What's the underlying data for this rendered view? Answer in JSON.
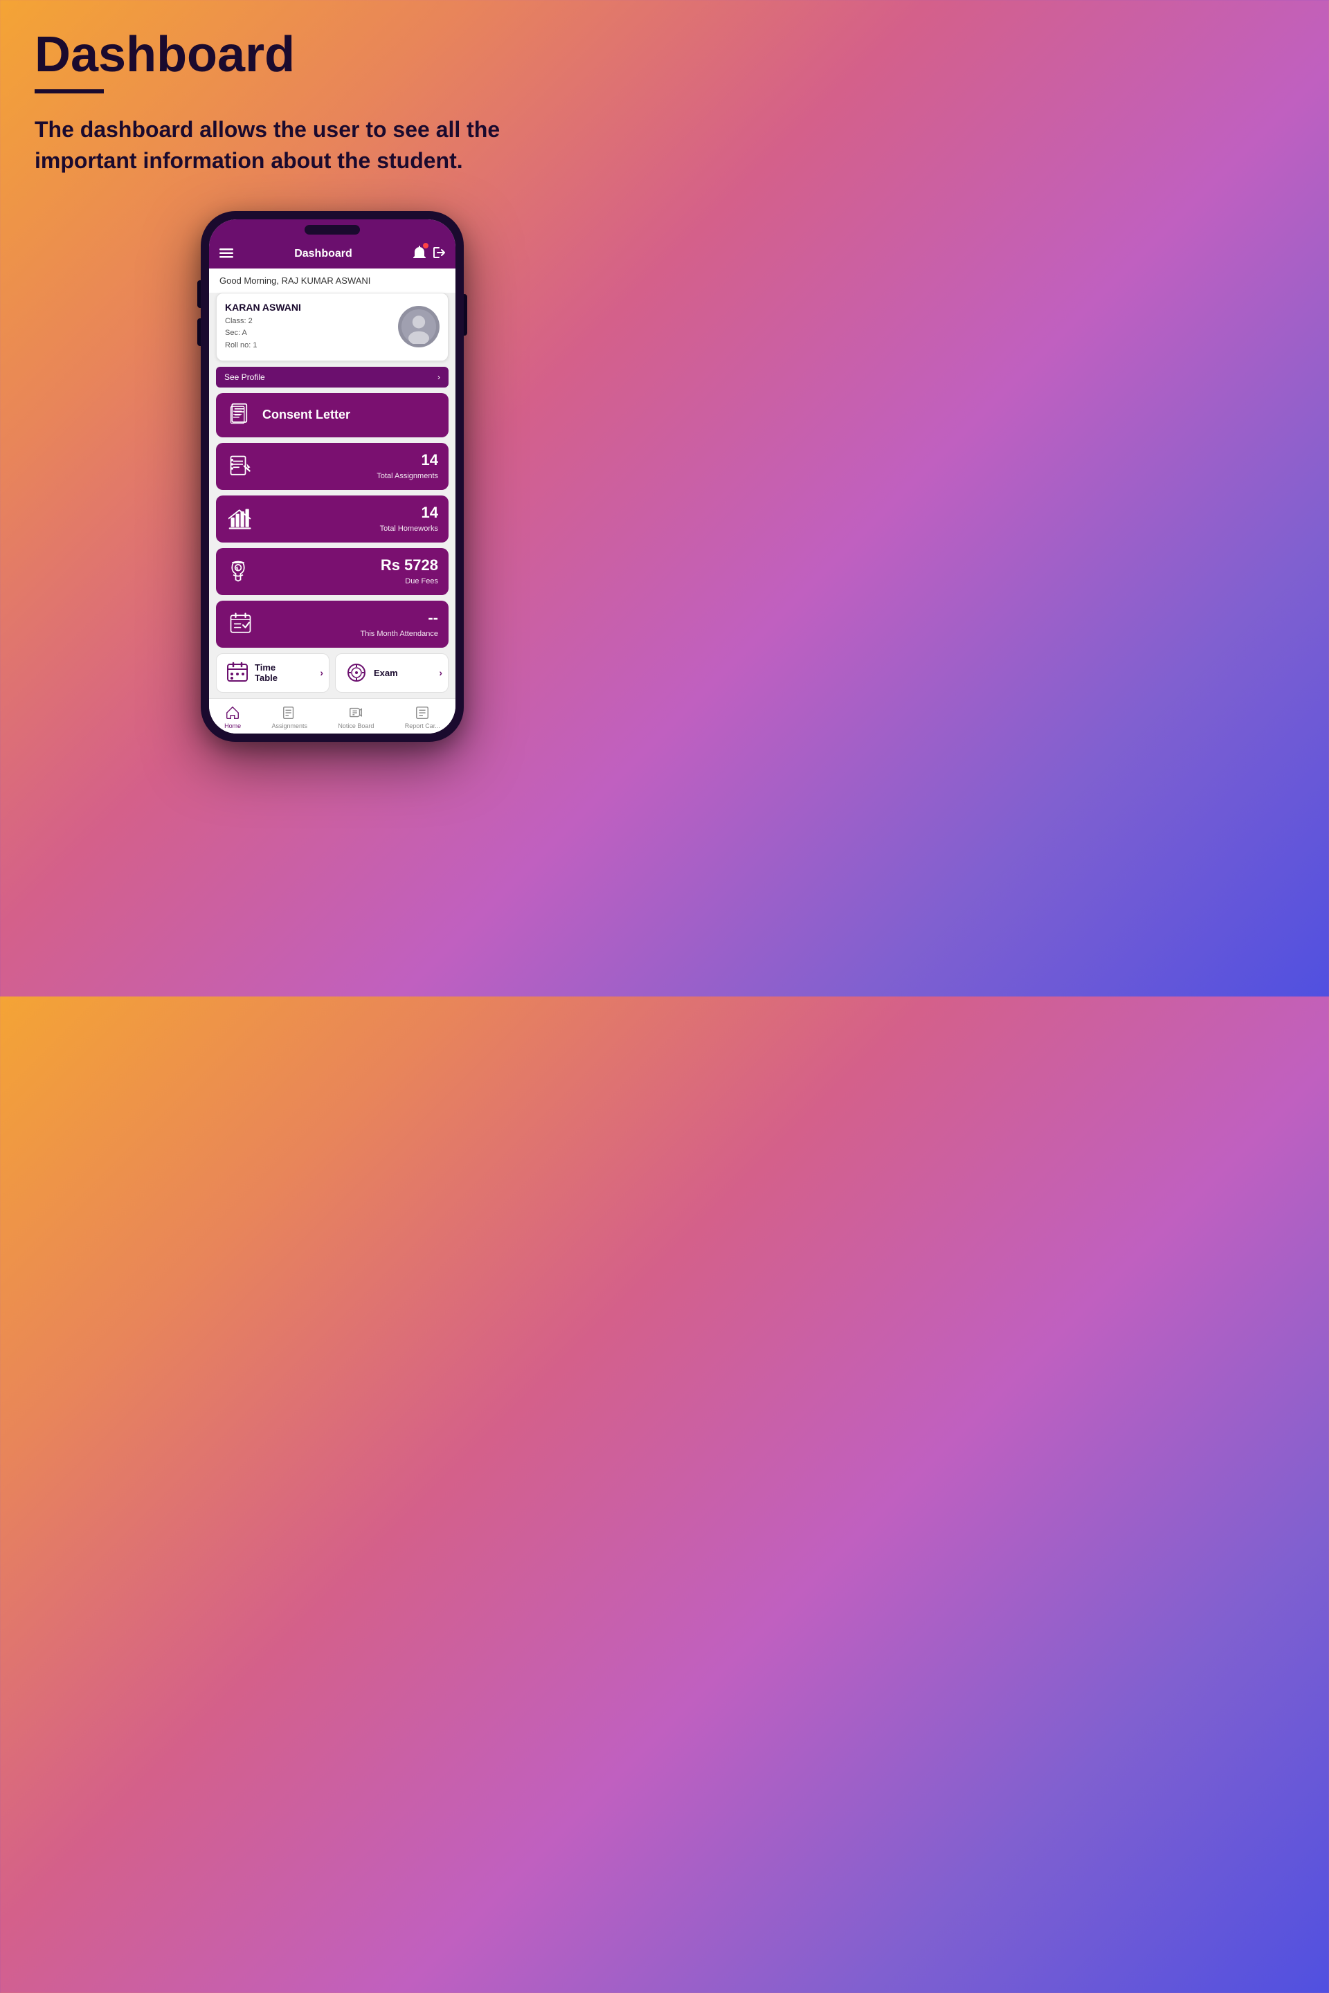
{
  "page": {
    "title": "Dashboard",
    "description": "The dashboard allows the user to see all the important information about the student."
  },
  "app": {
    "header": {
      "title": "Dashboard",
      "menu_icon": "≡",
      "notification_icon": "🔔",
      "logout_icon": "⬚"
    },
    "greeting": "Good Morning, RAJ KUMAR ASWANI",
    "student": {
      "name": "KARAN ASWANI",
      "class": "Class: 2",
      "section": "Sec: A",
      "roll": "Roll no: 1"
    },
    "see_profile_label": "See Profile",
    "menu_items": [
      {
        "id": "consent-letter",
        "label": "Consent Letter",
        "count": "",
        "sublabel": ""
      },
      {
        "id": "assignments",
        "label": "",
        "count": "14",
        "sublabel": "Total Assignments"
      },
      {
        "id": "homeworks",
        "label": "",
        "count": "14",
        "sublabel": "Total Homeworks"
      },
      {
        "id": "fees",
        "label": "",
        "count": "Rs 5728",
        "sublabel": "Due Fees"
      },
      {
        "id": "attendance",
        "label": "",
        "count": "--",
        "sublabel": "This Month Attendance"
      }
    ],
    "bottom_grid": [
      {
        "id": "timetable",
        "label": "Time\nTable"
      },
      {
        "id": "exam",
        "label": "Exam"
      }
    ],
    "bottom_nav": [
      {
        "id": "home",
        "label": "Home",
        "active": true
      },
      {
        "id": "assignments-nav",
        "label": "Assignments",
        "active": false
      },
      {
        "id": "notice-board",
        "label": "Notice Board",
        "active": false
      },
      {
        "id": "report-card",
        "label": "Report Car...",
        "active": false
      }
    ]
  }
}
